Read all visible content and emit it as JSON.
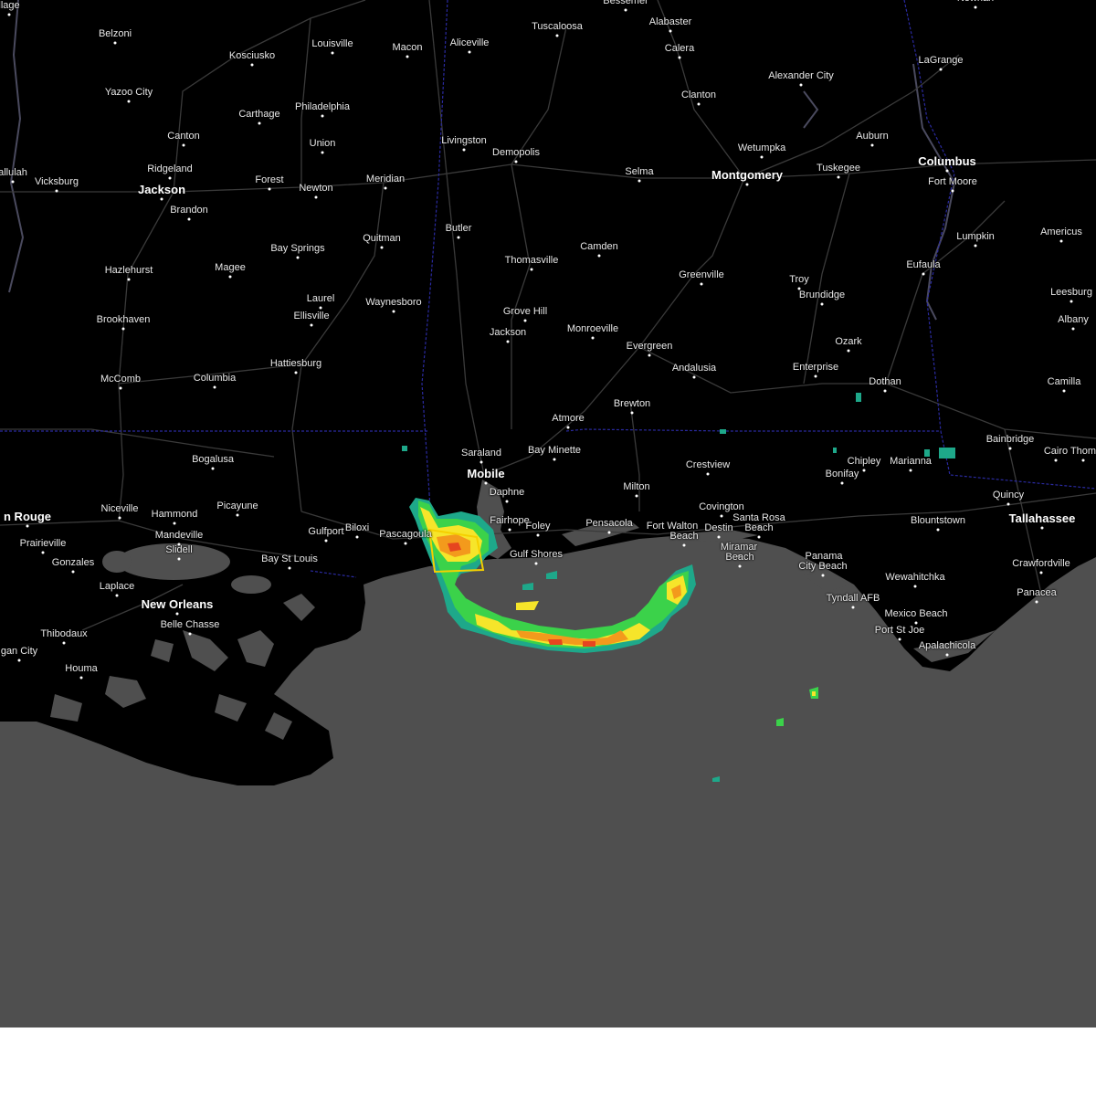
{
  "map": {
    "colors": {
      "land": "#000000",
      "water": "#4f4f4f",
      "roads": "#3a3a3a",
      "state_border": "#2a2aa0",
      "warning_box": "#f5d000",
      "radar_light": "#1ea88a",
      "radar_green": "#3bd24a",
      "radar_yellow": "#f6e52a",
      "radar_orange": "#f39a1c",
      "radar_red": "#e6451f"
    },
    "cities": [
      {
        "name": "Belzoni",
        "major": false
      },
      {
        "name": "Kosciusko",
        "major": false
      },
      {
        "name": "Louisville",
        "major": false
      },
      {
        "name": "Macon",
        "major": false
      },
      {
        "name": "Aliceville",
        "major": false
      },
      {
        "name": "Tuscaloosa",
        "major": false
      },
      {
        "name": "Bessemer",
        "major": false
      },
      {
        "name": "Alabaster",
        "major": false
      },
      {
        "name": "Calera",
        "major": false
      },
      {
        "name": "Alexander City",
        "major": false
      },
      {
        "name": "LaGrange",
        "major": false
      },
      {
        "name": "Newnan",
        "major": false
      },
      {
        "name": "Yazoo City",
        "major": false
      },
      {
        "name": "Carthage",
        "major": false
      },
      {
        "name": "Philadelphia",
        "major": false
      },
      {
        "name": "Union",
        "major": false
      },
      {
        "name": "Canton",
        "major": false
      },
      {
        "name": "Livingston",
        "major": false
      },
      {
        "name": "Demopolis",
        "major": false
      },
      {
        "name": "Clanton",
        "major": false
      },
      {
        "name": "Wetumpka",
        "major": false
      },
      {
        "name": "Auburn",
        "major": false
      },
      {
        "name": "Tuskegee",
        "major": false
      },
      {
        "name": "Columbus",
        "major": true
      },
      {
        "name": "Fort Moore",
        "major": false
      },
      {
        "name": "Ridgeland",
        "major": false
      },
      {
        "name": "Vicksburg",
        "major": false
      },
      {
        "name": "allulah",
        "major": false
      },
      {
        "name": "Jackson",
        "major": true
      },
      {
        "name": "Forest",
        "major": false
      },
      {
        "name": "Newton",
        "major": false
      },
      {
        "name": "Meridian",
        "major": false
      },
      {
        "name": "Selma",
        "major": false
      },
      {
        "name": "Montgomery",
        "major": true
      },
      {
        "name": "Brandon",
        "major": false
      },
      {
        "name": "Butler",
        "major": false
      },
      {
        "name": "Lumpkin",
        "major": false
      },
      {
        "name": "Americus",
        "major": false
      },
      {
        "name": "Quitman",
        "major": false
      },
      {
        "name": "Bay Springs",
        "major": false
      },
      {
        "name": "Camden",
        "major": false
      },
      {
        "name": "Thomasville",
        "major": false
      },
      {
        "name": "Eufaula",
        "major": false
      },
      {
        "name": "Hazlehurst",
        "major": false
      },
      {
        "name": "Magee",
        "major": false
      },
      {
        "name": "Greenville",
        "major": false
      },
      {
        "name": "Troy",
        "major": false
      },
      {
        "name": "Brundidge",
        "major": false
      },
      {
        "name": "Leesburg",
        "major": false
      },
      {
        "name": "Laurel",
        "major": false
      },
      {
        "name": "Waynesboro",
        "major": false
      },
      {
        "name": "Grove Hill",
        "major": false
      },
      {
        "name": "Ellisville",
        "major": false
      },
      {
        "name": "Brookhaven",
        "major": false
      },
      {
        "name": "Albany",
        "major": false
      },
      {
        "name": "Monroeville",
        "major": false
      },
      {
        "name": "Jackson",
        "major": false
      },
      {
        "name": "Ozark",
        "major": false
      },
      {
        "name": "Evergreen",
        "major": false
      },
      {
        "name": "Hattiesburg",
        "major": false
      },
      {
        "name": "Andalusia",
        "major": false
      },
      {
        "name": "Enterprise",
        "major": false
      },
      {
        "name": "McComb",
        "major": false
      },
      {
        "name": "Columbia",
        "major": false
      },
      {
        "name": "Dothan",
        "major": false
      },
      {
        "name": "Camilla",
        "major": false
      },
      {
        "name": "Brewton",
        "major": false
      },
      {
        "name": "Atmore",
        "major": false
      },
      {
        "name": "Bainbridge",
        "major": false
      },
      {
        "name": "Bay Minette",
        "major": false
      },
      {
        "name": "Saraland",
        "major": false
      },
      {
        "name": "Cairo",
        "major": false
      },
      {
        "name": "Thom",
        "major": false
      },
      {
        "name": "Bogalusa",
        "major": false
      },
      {
        "name": "Chipley",
        "major": false
      },
      {
        "name": "Marianna",
        "major": false
      },
      {
        "name": "Crestview",
        "major": false
      },
      {
        "name": "Mobile",
        "major": true
      },
      {
        "name": "Bonifay",
        "major": false
      },
      {
        "name": "Milton",
        "major": false
      },
      {
        "name": "Daphne",
        "major": false
      },
      {
        "name": "Quincy",
        "major": false
      },
      {
        "name": "Picayune",
        "major": false
      },
      {
        "name": "Niceville",
        "major": false
      },
      {
        "name": "Hammond",
        "major": false
      },
      {
        "name": "Covington",
        "major": false
      },
      {
        "name": "Santa Rosa",
        "major": false
      },
      {
        "name": "Blountstown",
        "major": false
      },
      {
        "name": "Fairhope",
        "major": false
      },
      {
        "name": "Pensacola",
        "major": false
      },
      {
        "name": "Tallahassee",
        "major": true
      },
      {
        "name": "n Rouge",
        "major": true
      },
      {
        "name": "Foley",
        "major": false
      },
      {
        "name": "Fort Walton",
        "major": false
      },
      {
        "name": "Destin",
        "major": false
      },
      {
        "name": "Beach",
        "major": false
      },
      {
        "name": "Gulfport",
        "major": false
      },
      {
        "name": "Biloxi",
        "major": false
      },
      {
        "name": "Pascagoula",
        "major": false
      },
      {
        "name": "Mandeville",
        "major": false
      },
      {
        "name": "Beach",
        "major": false
      },
      {
        "name": "Prairieville",
        "major": false
      },
      {
        "name": "Gulf Shores",
        "major": false
      },
      {
        "name": "Miramar",
        "major": false
      },
      {
        "name": "Slidell",
        "major": false
      },
      {
        "name": "Beach",
        "major": false
      },
      {
        "name": "Panama",
        "major": false
      },
      {
        "name": "Gonzales",
        "major": false
      },
      {
        "name": "Bay St Louis",
        "major": false
      },
      {
        "name": "City Beach",
        "major": false
      },
      {
        "name": "Crawfordville",
        "major": false
      },
      {
        "name": "Wewahitchka",
        "major": false
      },
      {
        "name": "Laplace",
        "major": false
      },
      {
        "name": "Panacea",
        "major": false
      },
      {
        "name": "Tyndall AFB",
        "major": false
      },
      {
        "name": "New Orleans",
        "major": true
      },
      {
        "name": "Mexico Beach",
        "major": false
      },
      {
        "name": "Belle Chasse",
        "major": false
      },
      {
        "name": "Port St Joe",
        "major": false
      },
      {
        "name": "Thibodaux",
        "major": false
      },
      {
        "name": "Apalachicola",
        "major": false
      },
      {
        "name": "gan City",
        "major": false
      },
      {
        "name": "Houma",
        "major": false
      },
      {
        "name": "llage",
        "major": false
      }
    ]
  }
}
